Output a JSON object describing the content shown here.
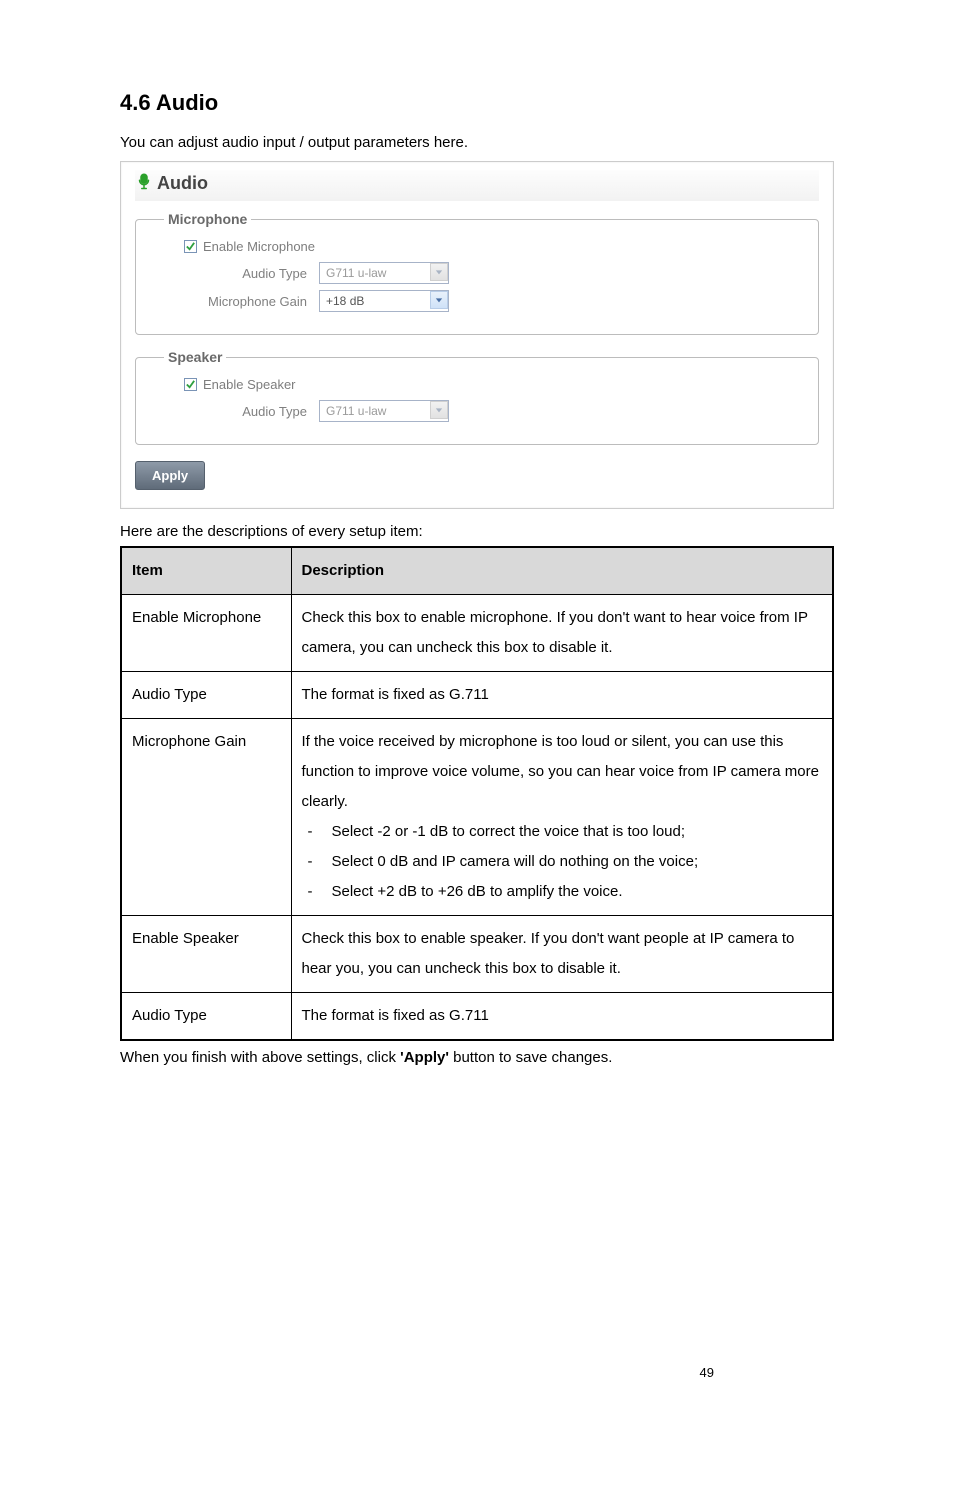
{
  "section_heading": "4.6 Audio",
  "intro_text": "You can adjust audio input / output parameters here.",
  "panel": {
    "title": "Audio",
    "microphone": {
      "legend": "Microphone",
      "enable_label": "Enable Microphone",
      "enable_checked": true,
      "audio_type_label": "Audio Type",
      "audio_type_value": "G711 u-law",
      "gain_label": "Microphone Gain",
      "gain_value": "+18 dB"
    },
    "speaker": {
      "legend": "Speaker",
      "enable_label": "Enable Speaker",
      "enable_checked": true,
      "audio_type_label": "Audio Type",
      "audio_type_value": "G711 u-law"
    },
    "apply_label": "Apply"
  },
  "descriptions_lead": "Here are the descriptions of every setup item:",
  "table": {
    "header_item": "Item",
    "header_desc": "Description",
    "rows": [
      {
        "item": "Enable Microphone",
        "desc": "Check this box to enable microphone. If you don't want to hear voice from IP camera, you can uncheck this box to disable it."
      },
      {
        "item": "Audio Type",
        "desc": "The format is fixed as G.711"
      },
      {
        "item": "Microphone Gain",
        "desc_intro": "If the voice received by microphone is too loud or silent, you can use this function to improve voice volume, so you can hear voice from IP camera more clearly.",
        "bullets": [
          "Select -2 or -1 dB to correct the voice that is too loud;",
          "Select 0 dB and IP camera will do nothing on the voice;",
          "Select +2 dB to +26 dB to amplify the voice."
        ]
      },
      {
        "item": "Enable Speaker",
        "desc": "Check this box to enable speaker. If you don't want people at IP camera to hear you, you can uncheck this box to disable it."
      },
      {
        "item": "Audio Type",
        "desc": "The format is fixed as G.711"
      }
    ]
  },
  "footer_text_pre": "When you finish with above settings, click ",
  "footer_text_bold": "'Apply'",
  "footer_text_post": " button to save changes.",
  "page_number": "49"
}
